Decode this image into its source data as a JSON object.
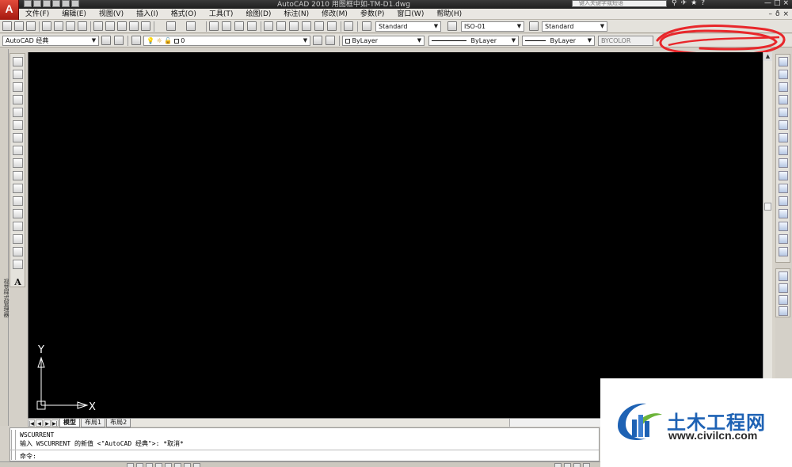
{
  "title_bar": {
    "app_logo": "A",
    "title": "AutoCAD 2010    用图框中如-TM-D1.dwg",
    "search_placeholder": "键入关键字或短语",
    "window_controls": [
      "—",
      "□",
      "×"
    ],
    "icons": [
      "binoculars-icon",
      "satellite-icon",
      "star-icon",
      "help-icon"
    ]
  },
  "menu": {
    "items": [
      "文件(F)",
      "编辑(E)",
      "视图(V)",
      "插入(I)",
      "格式(O)",
      "工具(T)",
      "绘图(D)",
      "标注(N)",
      "修改(M)",
      "参数(P)",
      "窗口(W)",
      "帮助(H)"
    ],
    "doc_controls": [
      "–",
      "ð",
      "×"
    ]
  },
  "toolbar_standard": {
    "text_style": "Standard",
    "dim_style": "ISO-01",
    "table_style": "Standard"
  },
  "toolbar_properties": {
    "workspace": "AutoCAD 经典",
    "layer": "0",
    "color": "ByLayer",
    "linetype": "ByLayer",
    "lineweight": "ByLayer",
    "plot_style": "BYCOLOR"
  },
  "left_palette": {
    "label": "视觉样式管理器",
    "text_tool": "A"
  },
  "ucs": {
    "x_label": "X",
    "y_label": "Y"
  },
  "layout_tabs": {
    "items": [
      "模型",
      "布局1",
      "布局2"
    ],
    "active": "模型"
  },
  "command_line": {
    "history": [
      "WSCURRENT",
      "输入 WSCURRENT 的新值 <\"AutoCAD 经典\">: *取消*"
    ],
    "prompt": "命令:"
  },
  "colors": {
    "canvas": "#000000",
    "annotation_scribble": "#e8272b",
    "watermark_blue": "#1e62b4"
  },
  "watermark": {
    "title": "土木工程网",
    "url": "www.civilcn.com"
  }
}
